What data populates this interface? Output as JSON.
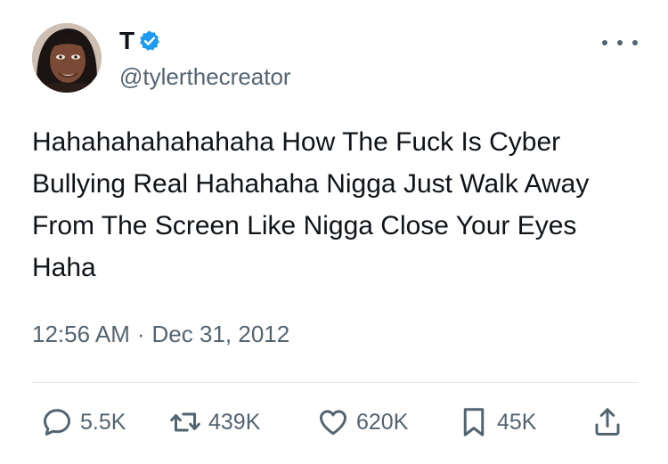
{
  "author": {
    "display_name": "T",
    "handle": "@tylerthecreator",
    "verified_badge": "verified-badge-icon",
    "avatar": "profile-avatar"
  },
  "tweet": {
    "text": "Hahahahahahahaha How The Fuck Is Cyber Bullying Real Hahahaha Nigga Just Walk Away From The Screen Like Nigga Close Your Eyes Haha",
    "time": "12:56 AM",
    "separator": "·",
    "date": "Dec 31, 2012"
  },
  "actions": {
    "reply": {
      "icon": "reply-icon",
      "count": "5.5K"
    },
    "retweet": {
      "icon": "retweet-icon",
      "count": "439K"
    },
    "like": {
      "icon": "heart-icon",
      "count": "620K"
    },
    "bookmark": {
      "icon": "bookmark-icon",
      "count": "45K"
    },
    "share": {
      "icon": "share-icon"
    }
  },
  "colors": {
    "text": "#0f1419",
    "secondary": "#536471",
    "verified_blue": "#1d9bf0",
    "divider": "#e6e9ec"
  }
}
